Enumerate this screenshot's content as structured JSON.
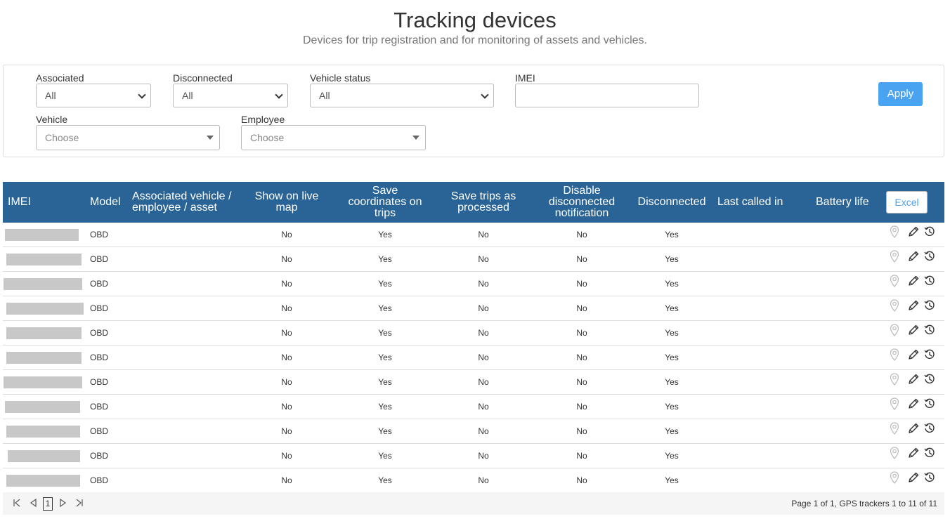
{
  "header": {
    "title": "Tracking devices",
    "subtitle": "Devices for trip registration and for monitoring of assets and vehicles."
  },
  "filters": {
    "associated": {
      "label": "Associated",
      "value": "All"
    },
    "disconnected": {
      "label": "Disconnected",
      "value": "All"
    },
    "vehicle_status": {
      "label": "Vehicle status",
      "value": "All"
    },
    "imei": {
      "label": "IMEI",
      "value": ""
    },
    "vehicle": {
      "label": "Vehicle",
      "value": "Choose"
    },
    "employee": {
      "label": "Employee",
      "value": "Choose"
    },
    "apply_label": "Apply"
  },
  "table": {
    "columns": {
      "imei": "IMEI",
      "model": "Model",
      "associated": "Associated vehicle / employee / asset",
      "show_live": "Show on live map",
      "save_coords": "Save coordinates on trips",
      "save_processed": "Save trips as processed",
      "disable_notif": "Disable disconnected notification",
      "disconnected": "Disconnected",
      "last_called": "Last called in",
      "battery": "Battery life"
    },
    "excel_label": "Excel",
    "rows": [
      {
        "model": "OBD",
        "show_live": "No",
        "save_coords": "Yes",
        "save_processed": "No",
        "disable_notif": "No",
        "disconnected": "Yes"
      },
      {
        "model": "OBD",
        "show_live": "No",
        "save_coords": "Yes",
        "save_processed": "No",
        "disable_notif": "No",
        "disconnected": "Yes"
      },
      {
        "model": "OBD",
        "show_live": "No",
        "save_coords": "Yes",
        "save_processed": "No",
        "disable_notif": "No",
        "disconnected": "Yes"
      },
      {
        "model": "OBD",
        "show_live": "No",
        "save_coords": "Yes",
        "save_processed": "No",
        "disable_notif": "No",
        "disconnected": "Yes"
      },
      {
        "model": "OBD",
        "show_live": "No",
        "save_coords": "Yes",
        "save_processed": "No",
        "disable_notif": "No",
        "disconnected": "Yes"
      },
      {
        "model": "OBD",
        "show_live": "No",
        "save_coords": "Yes",
        "save_processed": "No",
        "disable_notif": "No",
        "disconnected": "Yes"
      },
      {
        "model": "OBD",
        "show_live": "No",
        "save_coords": "Yes",
        "save_processed": "No",
        "disable_notif": "No",
        "disconnected": "Yes"
      },
      {
        "model": "OBD",
        "show_live": "No",
        "save_coords": "Yes",
        "save_processed": "No",
        "disable_notif": "No",
        "disconnected": "Yes"
      },
      {
        "model": "OBD",
        "show_live": "No",
        "save_coords": "Yes",
        "save_processed": "No",
        "disable_notif": "No",
        "disconnected": "Yes"
      },
      {
        "model": "OBD",
        "show_live": "No",
        "save_coords": "Yes",
        "save_processed": "No",
        "disable_notif": "No",
        "disconnected": "Yes"
      },
      {
        "model": "OBD",
        "show_live": "No",
        "save_coords": "Yes",
        "save_processed": "No",
        "disable_notif": "No",
        "disconnected": "Yes"
      }
    ],
    "row_actions": [
      "map-pin-icon",
      "pencil-icon",
      "history-icon"
    ]
  },
  "pager": {
    "current_page": "1",
    "info": "Page 1 of 1, GPS trackers 1 to 11 of 11"
  },
  "colors": {
    "header_bg": "#2a6496",
    "apply_bg": "#4aa3f0",
    "redaction": "#c8c8c8"
  }
}
